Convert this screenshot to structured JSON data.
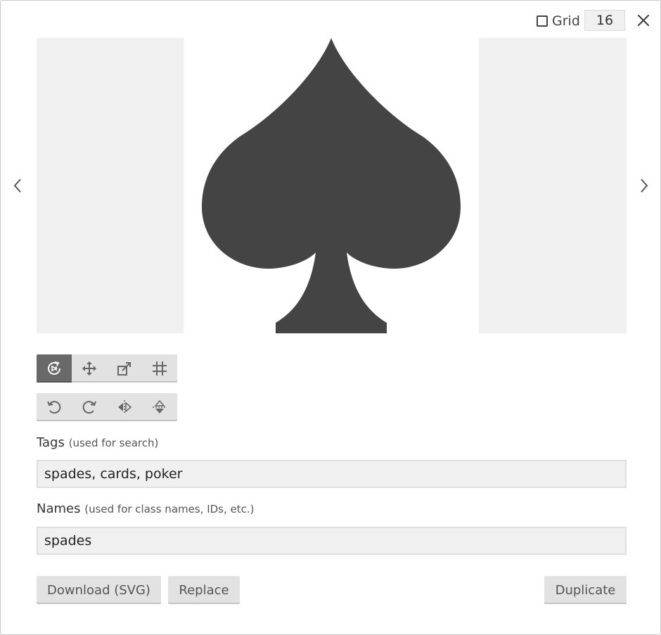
{
  "header": {
    "grid_label": "Grid",
    "grid_checked": false,
    "grid_size": "16",
    "close_icon": "close-icon"
  },
  "preview": {
    "icon": "spades",
    "fill_color": "#444444",
    "prev_icon": "chevron-left-icon",
    "next_icon": "chevron-right-icon"
  },
  "toolbars": {
    "mode": [
      {
        "icon": "rotate-mode-icon",
        "active": true
      },
      {
        "icon": "move-icon",
        "active": false
      },
      {
        "icon": "resize-icon",
        "active": false
      },
      {
        "icon": "crop-grid-icon",
        "active": false
      }
    ],
    "transform": [
      {
        "icon": "rotate-left-icon"
      },
      {
        "icon": "rotate-right-icon"
      },
      {
        "icon": "flip-horizontal-icon"
      },
      {
        "icon": "flip-vertical-icon"
      }
    ]
  },
  "fields": {
    "tags": {
      "label": "Tags",
      "hint": "(used for search)",
      "value": "spades, cards, poker"
    },
    "names": {
      "label": "Names",
      "hint": "(used for class names, IDs, etc.)",
      "value": "spades"
    }
  },
  "actions": {
    "download_label": "Download (SVG)",
    "replace_label": "Replace",
    "duplicate_label": "Duplicate"
  }
}
